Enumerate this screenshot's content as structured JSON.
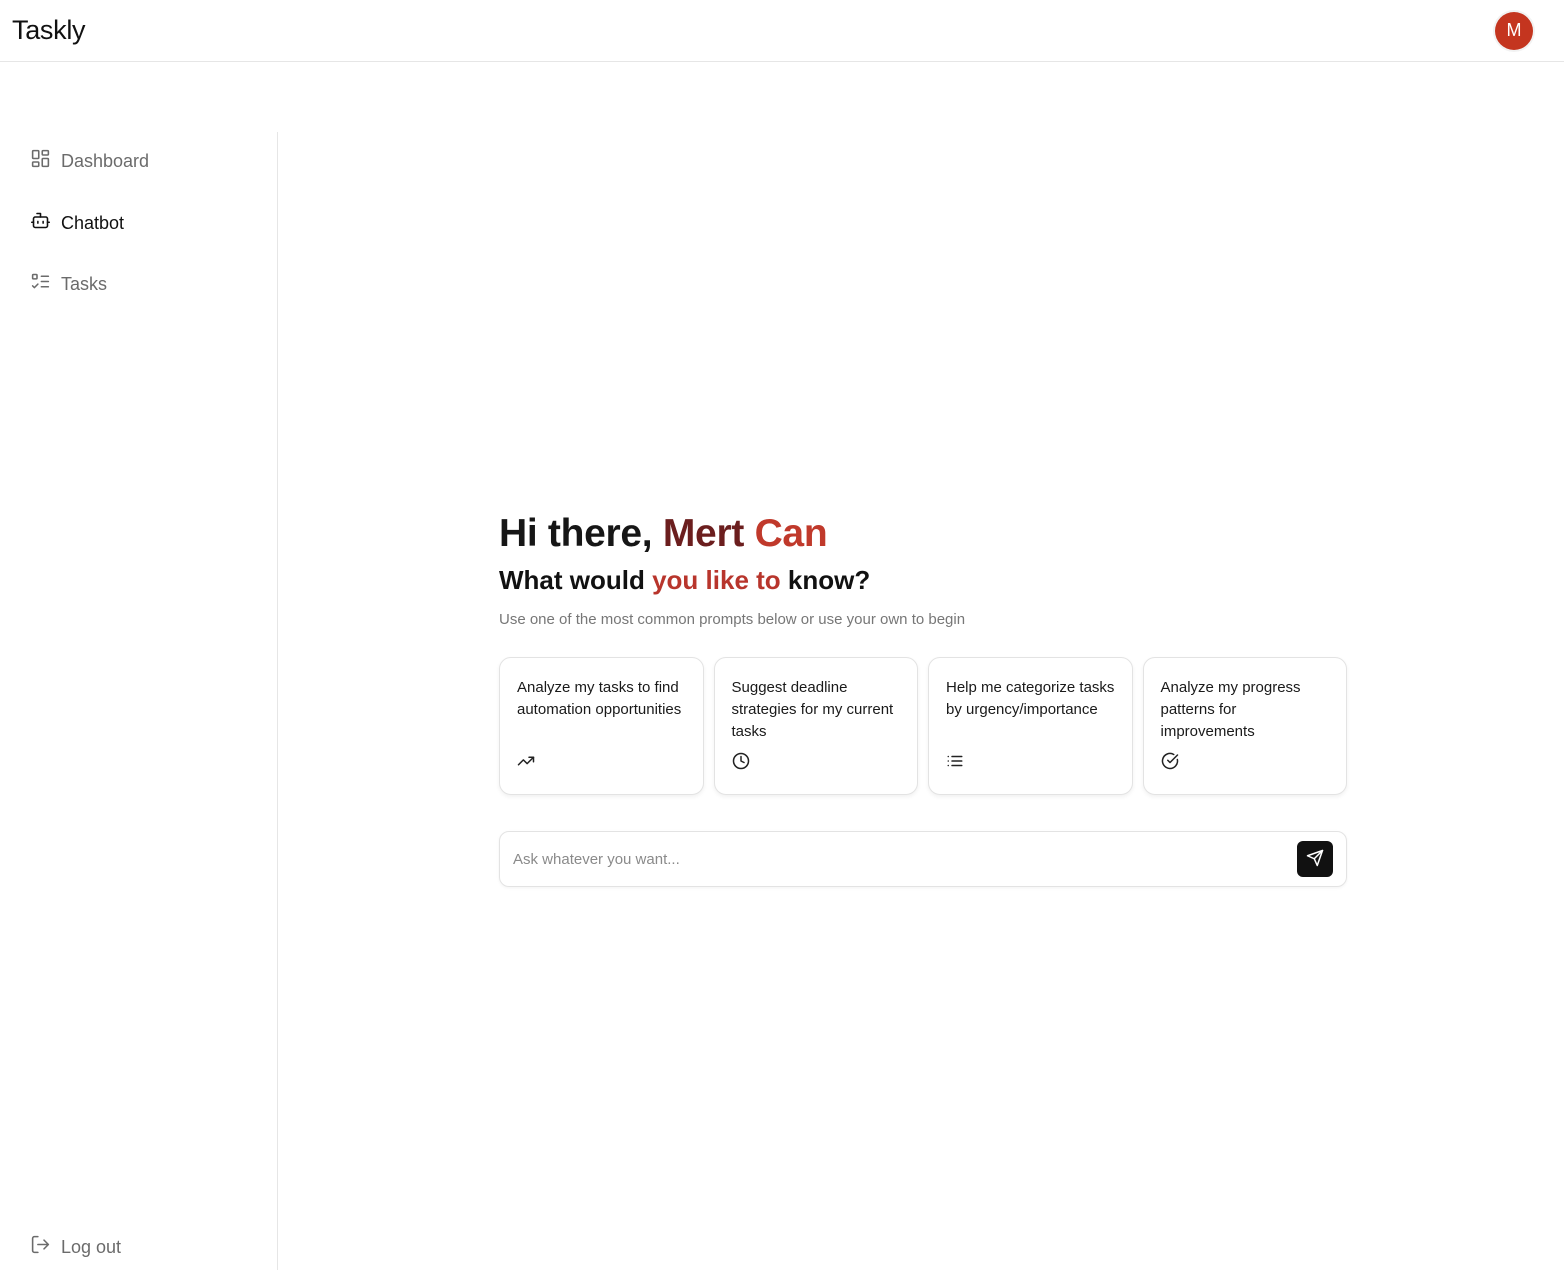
{
  "header": {
    "brand": "Taskly",
    "avatar_initial": "M"
  },
  "sidebar": {
    "items": [
      {
        "label": "Dashboard",
        "icon": "dashboard-grid-icon"
      },
      {
        "label": "Chatbot",
        "icon": "bot-icon",
        "active": true
      },
      {
        "label": "Tasks",
        "icon": "checklist-icon"
      }
    ],
    "logout": {
      "label": "Log out",
      "icon": "logout-icon"
    }
  },
  "main": {
    "greeting": {
      "part1": "Hi there, ",
      "part2": "Mert ",
      "part3": "Can"
    },
    "question": {
      "part1": "What would ",
      "part2": "you like to",
      "part3": " know?"
    },
    "hint": "Use one of the most common prompts below or use your own to begin",
    "cards": [
      {
        "text": "Analyze my tasks to find automation opportunities",
        "icon": "trending-up-icon"
      },
      {
        "text": "Suggest deadline strategies for my current tasks",
        "icon": "clock-icon"
      },
      {
        "text": "Help me categorize tasks by urgency/importance",
        "icon": "list-icon"
      },
      {
        "text": "Analyze my progress patterns for improvements",
        "icon": "check-circle-icon"
      }
    ],
    "input": {
      "placeholder": "Ask whatever you want...",
      "value": ""
    },
    "send_icon": "send-icon"
  },
  "colors": {
    "avatar": "#c4351f",
    "accent_dark": "#6b1e1e",
    "accent": "#c0392b"
  }
}
